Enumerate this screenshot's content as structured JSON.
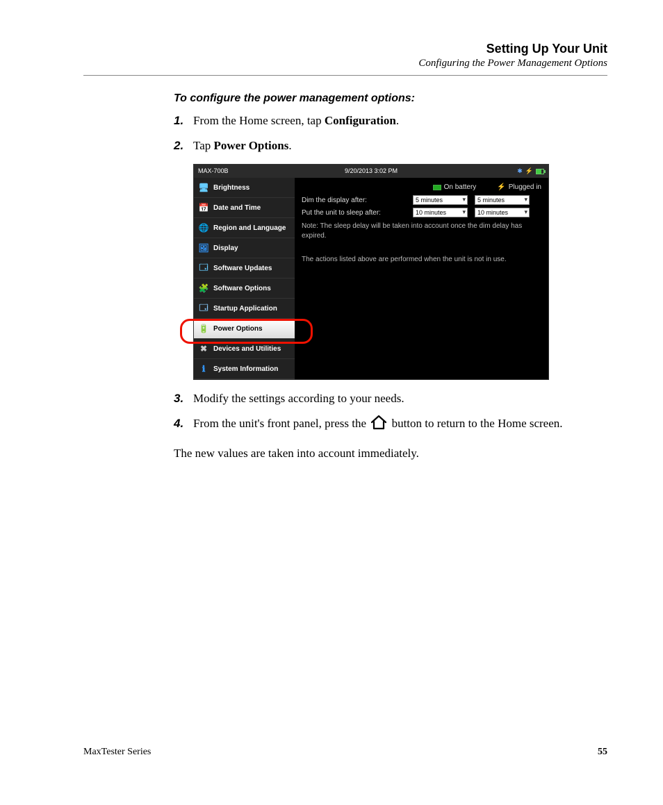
{
  "header": {
    "title": "Setting Up Your Unit",
    "subtitle": "Configuring the Power Management Options"
  },
  "task_heading": "To configure the power management options:",
  "steps": {
    "s1": {
      "num": "1.",
      "pre": "From the Home screen, tap ",
      "bold": "Configuration",
      "post": "."
    },
    "s2": {
      "num": "2.",
      "pre": "Tap ",
      "bold": "Power Options",
      "post": "."
    },
    "s3": {
      "num": "3.",
      "text": "Modify the settings according to your needs."
    },
    "s4": {
      "num": "4.",
      "pre": "From the unit's front panel, press the ",
      "post": " button to return to the Home screen."
    }
  },
  "closing": "The new values are taken into account immediately.",
  "footer": {
    "series": "MaxTester Series",
    "page": "55"
  },
  "screenshot": {
    "titlebar": {
      "model": "MAX-700B",
      "datetime": "9/20/2013 3:02 PM"
    },
    "sidebar": {
      "items": [
        {
          "label": "Brightness"
        },
        {
          "label": "Date and Time"
        },
        {
          "label": "Region and Language"
        },
        {
          "label": "Display"
        },
        {
          "label": "Software Updates"
        },
        {
          "label": "Software Options"
        },
        {
          "label": "Startup Application"
        },
        {
          "label": "Power Options"
        },
        {
          "label": "Devices and Utilities"
        },
        {
          "label": "System Information"
        }
      ],
      "selected_index": 7
    },
    "panel": {
      "col_battery": "On battery",
      "col_plugged": "Plugged in",
      "dim_label": "Dim the display after:",
      "dim_battery_value": "5 minutes",
      "dim_plugged_value": "5 minutes",
      "sleep_label": "Put the unit to sleep after:",
      "sleep_battery_value": "10 minutes",
      "sleep_plugged_value": "10 minutes",
      "note1": "Note: The sleep delay will be taken into account once the dim delay has expired.",
      "note2": "The actions listed above are performed when the unit is not in use."
    }
  }
}
